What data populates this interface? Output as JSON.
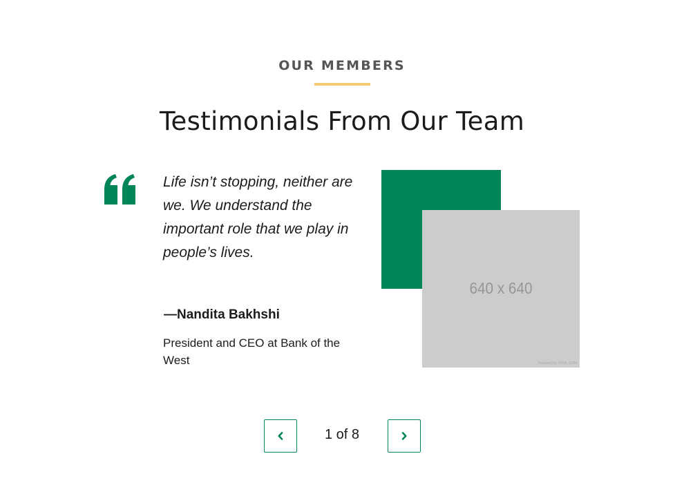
{
  "section": {
    "eyebrow": "OUR MEMBERS",
    "title": "Testimonials From Our Team"
  },
  "testimonial": {
    "quote": "Life isn’t stopping, neither are we. We understand the important role that we play in people’s lives.",
    "author": "—Nandita Bakhshi",
    "role": "President and CEO at Bank of the West",
    "image": {
      "label": "640 x 640",
      "credit": "Powered by: HTML.COM"
    }
  },
  "pagination": {
    "current": 1,
    "total": 8,
    "status": "1 of 8",
    "prev_icon": "chevron-left-icon",
    "next_icon": "chevron-right-icon"
  },
  "colors": {
    "brand_green": "#008556",
    "accent_yellow": "#f3cd74",
    "placeholder_gray": "#cccccc"
  },
  "icons": {
    "quote": "quote-mark-icon"
  }
}
